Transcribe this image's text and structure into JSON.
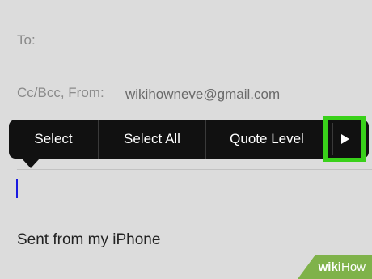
{
  "compose": {
    "to_label": "To:",
    "ccbcc_label": "Cc/Bcc, From:",
    "from_value": "wikihowneve@gmail.com",
    "signature": "Sent from my iPhone"
  },
  "edit_menu": {
    "items": [
      "Select",
      "Select All",
      "Quote Level"
    ],
    "next_icon": "right-triangle-icon",
    "highlight_color": "#39d11a"
  },
  "watermark": {
    "text_a": "wiki",
    "text_b": "How"
  }
}
